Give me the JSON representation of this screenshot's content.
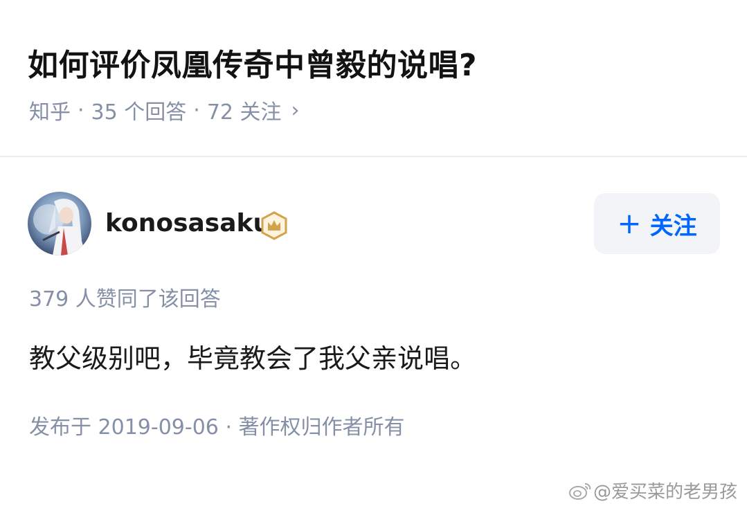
{
  "question": {
    "title": "如何评价凤凰传奇中曾毅的说唱?",
    "source": "知乎",
    "answers_count": "35 个回答",
    "followers_count": "72 关注"
  },
  "author": {
    "name": "konosasaku",
    "avatar_icon": "anime-avatar-icon",
    "badge_icon": "crown-badge-icon"
  },
  "follow_button": {
    "label": "关注",
    "icon": "plus-icon",
    "color": "#0066ff"
  },
  "answer": {
    "upvotes_text": "379 人赞同了该回答",
    "content": "教父级别吧，毕竟教会了我父亲说唱。",
    "published": "发布于 2019-09-06",
    "copyright": "著作权归作者所有"
  },
  "watermark": {
    "text": "@爱买菜的老男孩",
    "icon": "weibo-logo-icon"
  },
  "colors": {
    "meta_gray": "#8590a6",
    "accent_blue": "#0066ff",
    "badge_gold": "#d4a24c"
  }
}
